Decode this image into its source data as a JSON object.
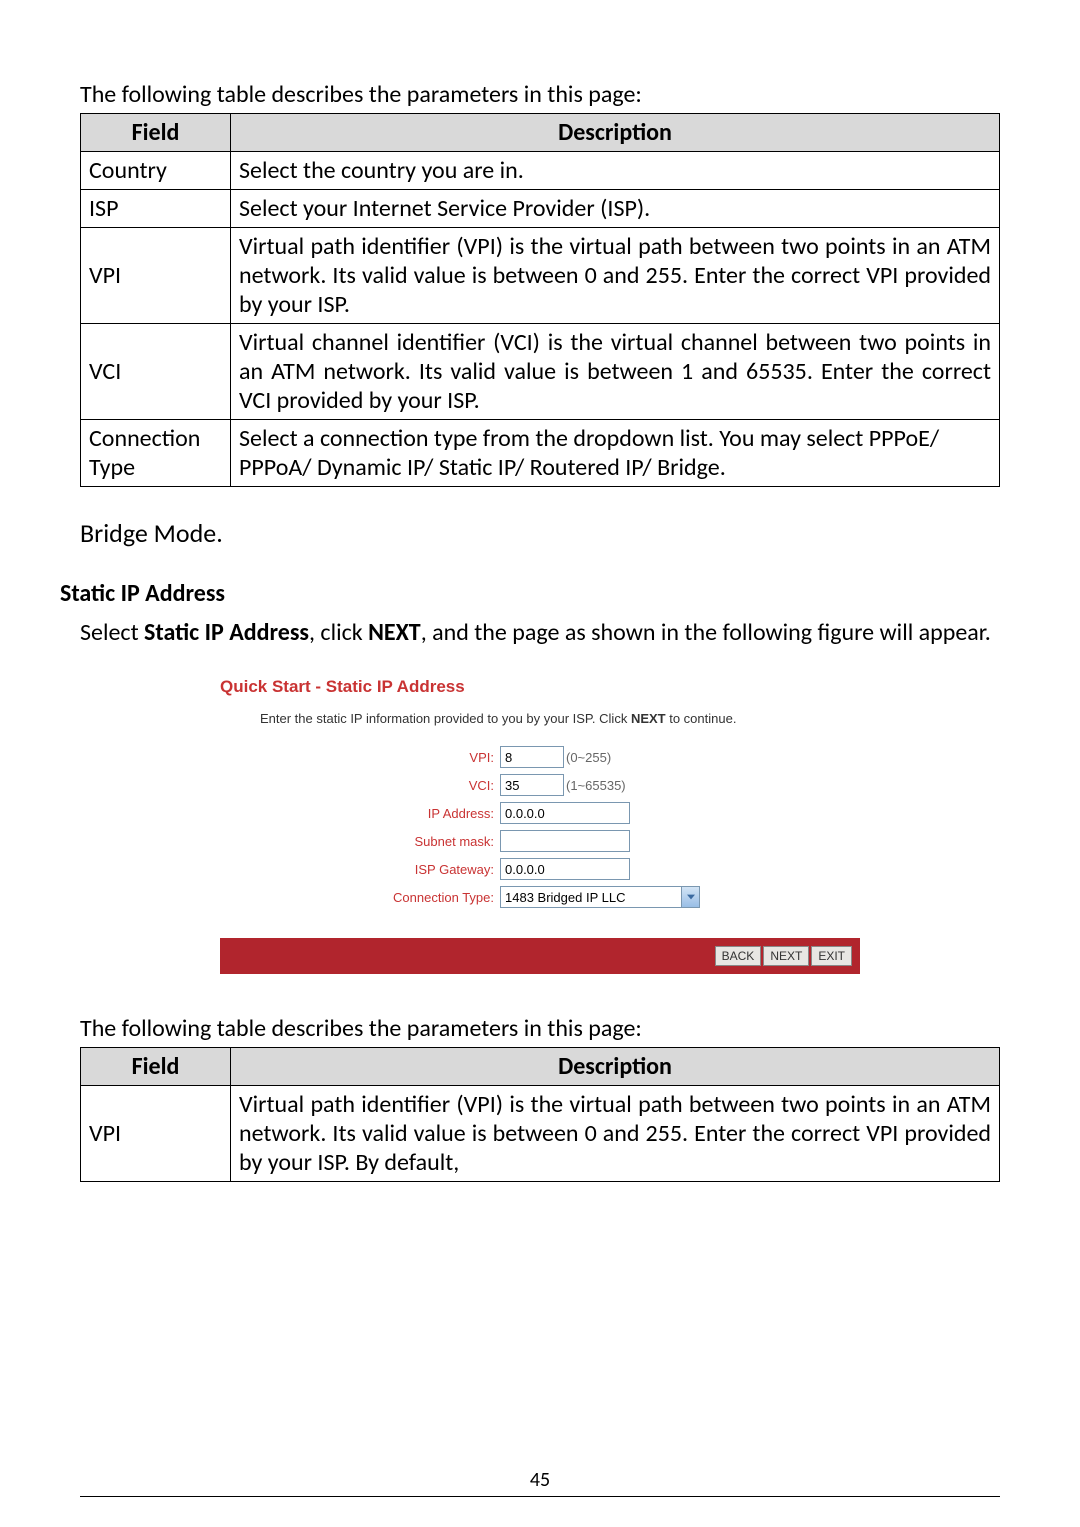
{
  "intro1": "The following table describes the parameters in this page:",
  "table1": {
    "headers": {
      "field": "Field",
      "description": "Description"
    },
    "rows": [
      {
        "field": "Country",
        "description": "Select the country you are in.",
        "justify": false
      },
      {
        "field": "ISP",
        "description": "Select your Internet Service Provider (ISP).",
        "justify": false
      },
      {
        "field": "VPI",
        "description": "Virtual path identifier (VPI) is the virtual path between two points in an ATM network. Its valid value is between 0 and 255. Enter the correct VPI provided by your ISP.",
        "justify": true
      },
      {
        "field": "VCI",
        "description": "Virtual channel identifier (VCI) is the virtual channel between two points in an ATM network. Its valid value is between 1 and 65535. Enter the correct VCI provided by your ISP.",
        "justify": true
      },
      {
        "field": "Connection Type",
        "description": "Select a connection type from the dropdown list. You may select PPPoE/ PPPoA/ Dynamic IP/ Static IP/ Routered IP/ Bridge.",
        "justify": false
      }
    ]
  },
  "section_heading": "Bridge Mode.",
  "sub_heading": "Static IP Address",
  "body_text_parts": {
    "p1": "Select ",
    "b1": "Static IP Address",
    "p2": ", click ",
    "b2": "NEXT",
    "p3": ", and the page as shown in the following figure will appear."
  },
  "quickstart": {
    "title": "Quick Start - Static IP Address",
    "subtext_p1": "Enter the static IP information provided to you by your ISP. Click ",
    "subtext_bold": "NEXT",
    "subtext_p2": " to continue.",
    "fields": {
      "vpi": {
        "label": "VPI:",
        "value": "8",
        "range": "(0~255)"
      },
      "vci": {
        "label": "VCI:",
        "value": "35",
        "range": "(1~65535)"
      },
      "ip": {
        "label": "IP Address:",
        "value": "0.0.0.0"
      },
      "subnet": {
        "label": "Subnet mask:",
        "value": ""
      },
      "gateway": {
        "label": "ISP Gateway:",
        "value": "0.0.0.0"
      },
      "conntype": {
        "label": "Connection Type:",
        "value": "1483 Bridged IP LLC"
      }
    },
    "buttons": {
      "back": "BACK",
      "next": "NEXT",
      "exit": "EXIT"
    }
  },
  "intro2": "The following table describes the parameters in this page:",
  "table2": {
    "headers": {
      "field": "Field",
      "description": "Description"
    },
    "rows": [
      {
        "field": "VPI",
        "description": "Virtual path identifier (VPI) is the virtual path between two points in an ATM network. Its valid value is between 0 and 255. Enter the correct VPI provided by your ISP. By default,",
        "justify": true
      }
    ]
  },
  "page_number": "45"
}
